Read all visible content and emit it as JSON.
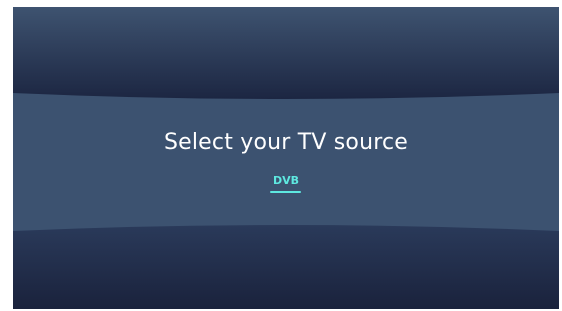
{
  "screen": {
    "title": "Select your TV source",
    "sources": [
      {
        "label": "DVB",
        "selected": true
      }
    ]
  },
  "colors": {
    "background_dark": "#1b2540",
    "panel": "#3c5270",
    "accent": "#5ee8e0",
    "text": "#ffffff"
  }
}
